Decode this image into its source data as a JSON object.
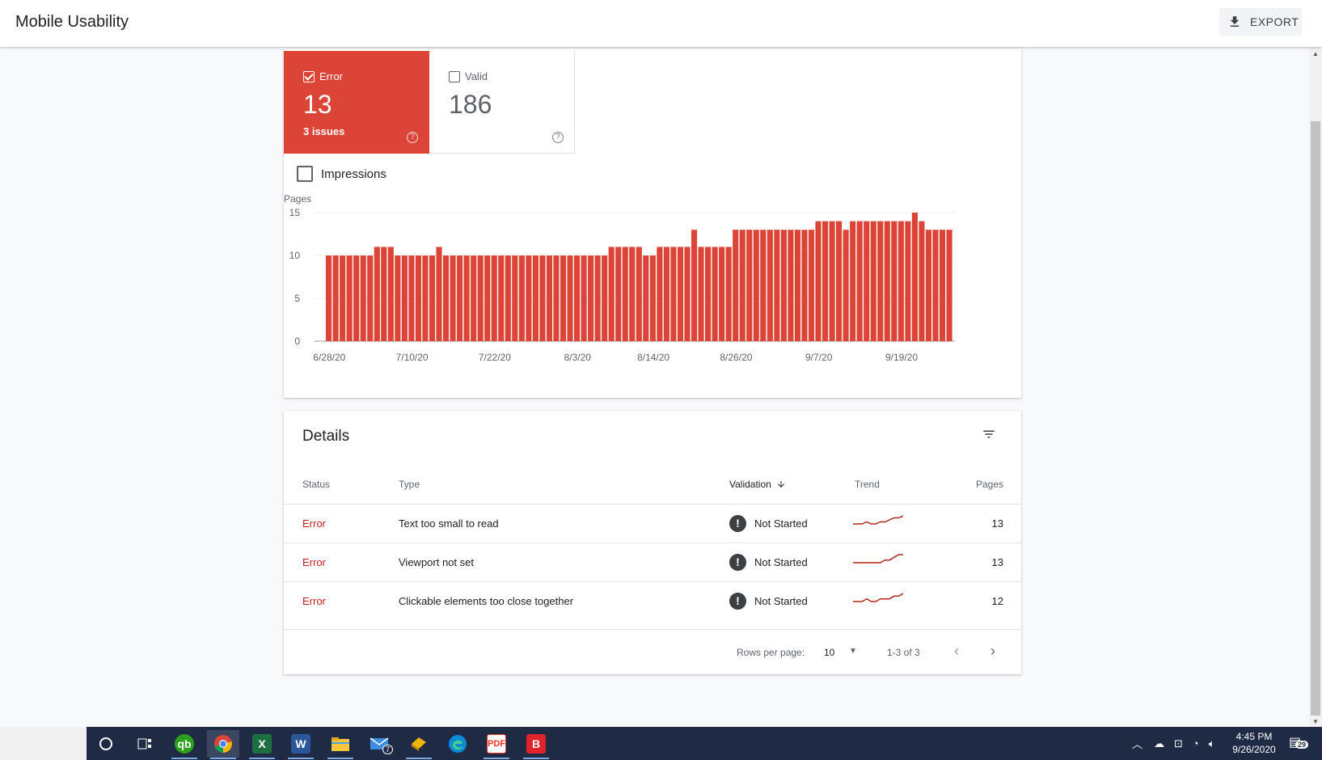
{
  "header": {
    "title": "Mobile Usability",
    "export_label": "EXPORT"
  },
  "summary": {
    "error": {
      "label": "Error",
      "count": "13",
      "sub": "3 issues",
      "checked": true,
      "color": "#db4437"
    },
    "valid": {
      "label": "Valid",
      "count": "186",
      "checked": false
    },
    "help_glyph": "?"
  },
  "impressions_label": "Impressions",
  "chart_data": {
    "type": "bar",
    "ylabel": "Pages",
    "ylim": [
      0,
      15
    ],
    "yticks": [
      "0",
      "5",
      "10",
      "15"
    ],
    "xtick_labels": [
      "6/28/20",
      "7/10/20",
      "7/22/20",
      "8/3/20",
      "8/14/20",
      "8/26/20",
      "9/7/20",
      "9/19/20"
    ],
    "color": "#db4437",
    "values": [
      10,
      10,
      10,
      10,
      10,
      10,
      10,
      11,
      11,
      11,
      10,
      10,
      10,
      10,
      10,
      10,
      11,
      10,
      10,
      10,
      10,
      10,
      10,
      10,
      10,
      10,
      10,
      10,
      10,
      10,
      10,
      10,
      10,
      10,
      10,
      10,
      10,
      10,
      10,
      10,
      10,
      11,
      11,
      11,
      11,
      11,
      10,
      10,
      11,
      11,
      11,
      11,
      11,
      13,
      11,
      11,
      11,
      11,
      11,
      13,
      13,
      13,
      13,
      13,
      13,
      13,
      13,
      13,
      13,
      13,
      13,
      14,
      14,
      14,
      14,
      13,
      14,
      14,
      14,
      14,
      14,
      14,
      14,
      14,
      14,
      15,
      14,
      13,
      13,
      13,
      13
    ]
  },
  "details": {
    "title": "Details",
    "columns": {
      "status": "Status",
      "type": "Type",
      "validation": "Validation",
      "trend": "Trend",
      "pages": "Pages"
    },
    "rows": [
      {
        "status": "Error",
        "type": "Text too small to read",
        "validation": "Not Started",
        "pages": "13",
        "trend": [
          10,
          10,
          10,
          11,
          10,
          10,
          11,
          11,
          12,
          13,
          13,
          14
        ]
      },
      {
        "status": "Error",
        "type": "Viewport not set",
        "validation": "Not Started",
        "pages": "13",
        "trend": [
          10,
          10,
          10,
          10,
          10,
          10,
          10,
          11,
          11,
          12,
          13,
          13
        ]
      },
      {
        "status": "Error",
        "type": "Clickable elements too close together",
        "validation": "Not Started",
        "pages": "12",
        "trend": [
          10,
          10,
          10,
          11,
          10,
          10,
          11,
          11,
          11,
          12,
          12,
          13
        ]
      }
    ],
    "footer": {
      "rows_per_page_label": "Rows per page:",
      "rows_per_page_value": "10",
      "range": "1-3 of 3"
    }
  },
  "taskbar": {
    "apps": [
      "cortana-icon",
      "task-view-icon",
      "quickbooks-icon",
      "chrome-icon",
      "excel-icon",
      "word-icon",
      "file-explorer-icon",
      "mail-icon",
      "stickies-icon",
      "edge-icon",
      "acrobat-icon",
      "bitdefender-icon"
    ],
    "mail_badge": "7",
    "time": "4:45 PM",
    "date": "9/26/2020",
    "notification_count": "29"
  }
}
